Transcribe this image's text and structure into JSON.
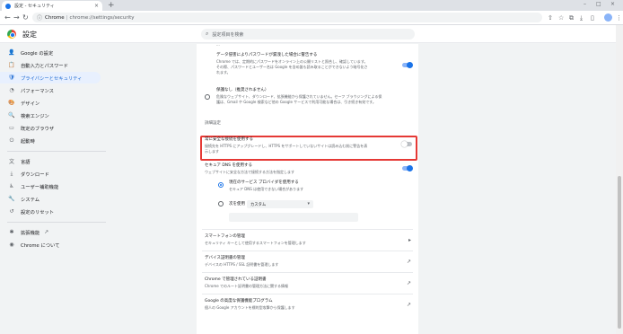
{
  "tab": {
    "title": "設定 - セキュリティ",
    "close": "×",
    "new_tab": "+"
  },
  "window_controls": {
    "minimize": "–",
    "maximize": "□",
    "close": "×"
  },
  "toolbar": {
    "back": "←",
    "forward": "→",
    "reload": "↻",
    "site": "Chrome",
    "separator": "|",
    "path": "chrome://settings/security",
    "share": "⇧",
    "bookmark": "☆",
    "extensions": "⧉",
    "downloads": "⤓",
    "sidepanel": "▯",
    "menu": "⋮"
  },
  "header": {
    "title": "設定",
    "search_placeholder": "設定項目を検索"
  },
  "sidebar": {
    "items": [
      {
        "icon": "👤",
        "label": "Google の設定"
      },
      {
        "icon": "📋",
        "label": "自動入力とパスワード"
      },
      {
        "icon": "🛡",
        "label": "プライバシーとセキュリティ"
      },
      {
        "icon": "◔",
        "label": "パフォーマンス"
      },
      {
        "icon": "🎨",
        "label": "デザイン"
      },
      {
        "icon": "🔍",
        "label": "検索エンジン"
      },
      {
        "icon": "▭",
        "label": "既定のブラウザ"
      },
      {
        "icon": "⏻",
        "label": "起動時"
      },
      {
        "icon": "文",
        "label": "言語"
      },
      {
        "icon": "⤓",
        "label": "ダウンロード"
      },
      {
        "icon": "♿",
        "label": "ユーザー補助機能"
      },
      {
        "icon": "🔧",
        "label": "システム"
      },
      {
        "icon": "↺",
        "label": "設定のリセット"
      },
      {
        "icon": "✱",
        "label": "拡張機能",
        "ext": "↗"
      },
      {
        "icon": "◉",
        "label": "Chrome について"
      }
    ]
  },
  "main": {
    "truncated_line": "...",
    "breach": {
      "title": "データ侵害によりパスワードが漏洩した場合に警告する",
      "desc1": "Chrome では、定期的にパスワードをオンライン上の公開リストと照合し、確認しています。",
      "desc2": "その際、パスワードとユーザー名は Google を含め誰も読み取ることができないよう暗号化さ",
      "desc3": "れます。"
    },
    "no_protection": {
      "title": "保護なし（推奨されません）",
      "desc1": "危険なウェブサイト、ダウンロード、拡張機能から保護されていません。セーフ ブラウジングによる保",
      "desc2": "護は、Gmail や Google 検索など他の Google サービスで利用可能な場合は、引き続き有効です。"
    },
    "advanced_heading": "詳細設定",
    "https": {
      "title": "常に安全な接続を使用する",
      "desc1": "接続先を HTTPS にアップグレードし、HTTPS をサポートしていないサイトは読み込む前に警告を表",
      "desc2": "示します"
    },
    "secure_dns": {
      "title": "セキュア DNS を使用する",
      "desc": "ウェブサイトに安全な方法で接続する方法を指定します",
      "opt1_title": "現在のサービス プロバイダを使用する",
      "opt1_desc": "セキュア DNS は使用できない場合があります",
      "opt2_label": "次を使用",
      "dropdown_value": "カスタム",
      "dropdown_arrow": "▾"
    },
    "phone": {
      "title": "スマートフォンの管理",
      "desc": "セキュリティ キーとして使用するスマートフォンを管理します",
      "icon": "▸"
    },
    "certs": {
      "title": "デバイス証明書の管理",
      "desc": "デバイスの HTTPS / SSL 証明書を管理します",
      "icon": "↗"
    },
    "chrome_certs": {
      "title": "Chrome で管理されている証明書",
      "desc": "Chrome でのルート証明書の管理方法に関する情報",
      "icon": "↗"
    },
    "advanced_protection": {
      "title": "Google の高度な保護機能プログラム",
      "desc": "個人の Google アカウントを標的型攻撃から保護します",
      "icon": "↗"
    }
  },
  "colors": {
    "accent": "#1a73e8",
    "highlight_border": "#e53935",
    "active_bg": "#e8f0fe"
  }
}
